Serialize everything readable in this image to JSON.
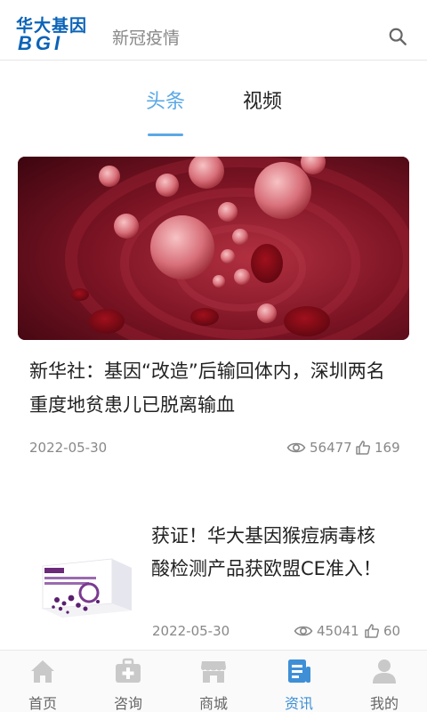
{
  "header": {
    "logo_cn": "华大基因",
    "logo_en": "BGI",
    "title": "新冠疫情"
  },
  "tabs": [
    {
      "label": "头条",
      "active": true
    },
    {
      "label": "视频",
      "active": false
    }
  ],
  "articles": [
    {
      "title": "新华社：基因“改造”后输回体内，深圳两名重度地贫患儿已脱离输血",
      "date": "2022-05-30",
      "views": "56477",
      "likes": "169"
    },
    {
      "title": "获证！华大基因猴痘病毒核酸检测产品获欧盟CE准入！",
      "date": "2022-05-30",
      "views": "45041",
      "likes": "60"
    }
  ],
  "bottom_nav": [
    {
      "label": "首页",
      "icon": "home-icon",
      "active": false
    },
    {
      "label": "咨询",
      "icon": "medical-kit-icon",
      "active": false
    },
    {
      "label": "商城",
      "icon": "store-icon",
      "active": false
    },
    {
      "label": "资讯",
      "icon": "news-icon",
      "active": true
    },
    {
      "label": "我的",
      "icon": "user-icon",
      "active": false
    }
  ],
  "colors": {
    "accent": "#5aa8e6",
    "brand": "#0a63b7",
    "nav_active": "#3f8fd6",
    "nav_inactive": "#c9c9c9"
  }
}
